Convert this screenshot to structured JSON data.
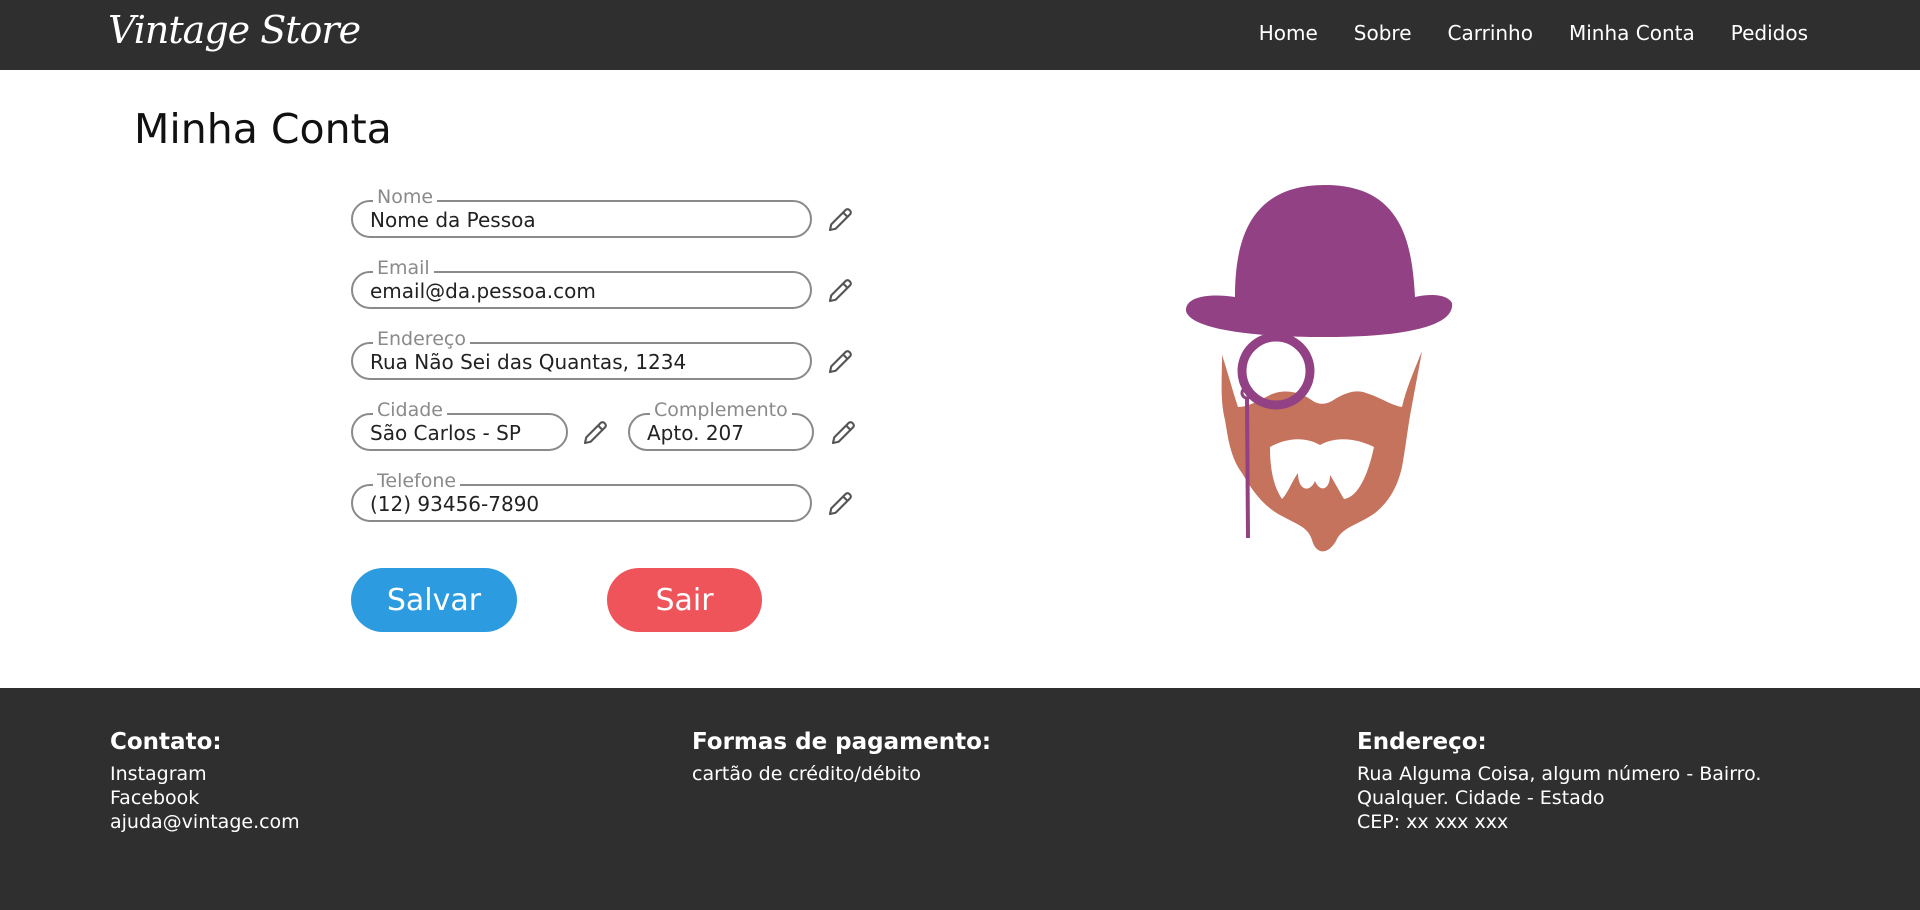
{
  "header": {
    "brand": "Vintage Store",
    "nav": [
      "Home",
      "Sobre",
      "Carrinho",
      "Minha Conta",
      "Pedidos"
    ]
  },
  "page": {
    "title": "Minha Conta"
  },
  "form": {
    "nome": {
      "label": "Nome",
      "value": "Nome da Pessoa"
    },
    "email": {
      "label": "Email",
      "value": "email@da.pessoa.com"
    },
    "endereco": {
      "label": "Endereço",
      "value": "Rua Não Sei das Quantas, 1234"
    },
    "cidade": {
      "label": "Cidade",
      "value": "São Carlos - SP"
    },
    "complemento": {
      "label": "Complemento",
      "value": "Apto. 207"
    },
    "telefone": {
      "label": "Telefone",
      "value": "(12) 93456-7890"
    },
    "edit_icon": "pencil-icon"
  },
  "actions": {
    "save": "Salvar",
    "exit": "Sair"
  },
  "colors": {
    "nav_bg": "#2f2f2f",
    "save": "#2d9be0",
    "exit": "#ee5459",
    "hat": "#914184",
    "beard": "#c5735c"
  },
  "footer": {
    "contact": {
      "heading": "Contato:",
      "lines": [
        "Instagram",
        "Facebook",
        "ajuda@vintage.com"
      ]
    },
    "payment": {
      "heading": "Formas de pagamento:",
      "lines": [
        "cartão de crédito/débito"
      ]
    },
    "address": {
      "heading": "Endereço:",
      "lines": [
        "Rua Alguma Coisa, algum número - Bairro.",
        "Qualquer. Cidade - Estado",
        "CEP: xx xxx xxx"
      ]
    }
  }
}
